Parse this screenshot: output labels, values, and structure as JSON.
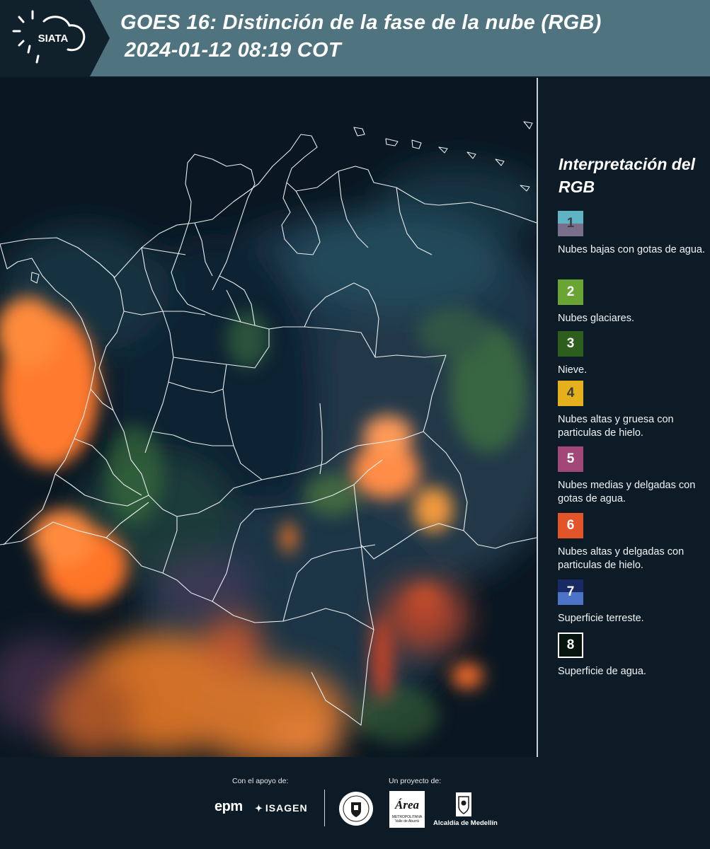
{
  "header": {
    "logo_text": "SIATA",
    "title_line1": "GOES 16: Distinción de la fase de la nube (RGB)",
    "title_line2": "2024-01-12 08:19 COT"
  },
  "legend": {
    "title": "Interpretación del RGB",
    "items": [
      {
        "number": "1",
        "label": "Nubes bajas con gotas de agua.",
        "color_top": "#5fb3c2",
        "color_bottom": "#7a6f8a",
        "text_color": "#3c3c46"
      },
      {
        "number": "2",
        "label": "Nubes glaciares.",
        "color_top": "#6aa533",
        "color_bottom": "#6aa533",
        "text_color": "#ffffff"
      },
      {
        "number": "3",
        "label": "Nieve.",
        "color_top": "#2e5e1e",
        "color_bottom": "#2e5e1e",
        "text_color": "#ffffff"
      },
      {
        "number": "4",
        "label": "Nubes altas y gruesa con particulas de hielo.",
        "color_top": "#e4b11d",
        "color_bottom": "#e4b11d",
        "text_color": "#3a3a3a"
      },
      {
        "number": "5",
        "label": "Nubes medias y delgadas con gotas de agua.",
        "color_top": "#a24879",
        "color_bottom": "#a24879",
        "text_color": "#ffffff"
      },
      {
        "number": "6",
        "label": "Nubes altas y delgadas con particulas de hielo.",
        "color_top": "#e2542a",
        "color_bottom": "#e2542a",
        "text_color": "#ffffff"
      },
      {
        "number": "7",
        "label": "Superficie terreste.",
        "color_top": "#182a63",
        "color_bottom": "#4d73c6",
        "text_color": "#ffffff"
      },
      {
        "number": "8",
        "label": "Superficie de agua.",
        "color_top": "#06140c",
        "color_bottom": "#06140c",
        "text_color": "#ffffff"
      }
    ]
  },
  "footer": {
    "support_label": "Con el apoyo de:",
    "project_label": "Un proyecto de:",
    "epm_text": "epm",
    "isagen_text": "ISAGEN",
    "area_text": "Área",
    "area_subtext": "METROPOLITANA Valle de Aburrá",
    "alcaldia_text": "Alcaldía de Medellín"
  }
}
